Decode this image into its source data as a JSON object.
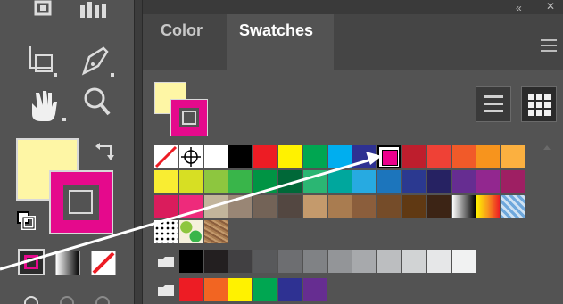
{
  "tabs": [
    {
      "label": "Color",
      "active": false
    },
    {
      "label": "Swatches",
      "active": true
    }
  ],
  "fill_color": "#fef6a5",
  "stroke_color": "#e5098c",
  "view_modes": [
    "list-view-icon",
    "grid-view-icon"
  ],
  "swatch_rows": [
    [
      "none",
      "registration",
      "#ffffff",
      "#000000",
      "#ed1c24",
      "#fff200",
      "#00a651",
      "#00aeef",
      "#2e3192",
      "#ec008c",
      "#be1e2d",
      "#ef4136",
      "#f15a29",
      "#f7941d",
      "#fbb040"
    ],
    [
      "#f9ed32",
      "#d7df23",
      "#8dc63f",
      "#39b54a",
      "#009444",
      "#006838",
      "#2bb673",
      "#00a79d",
      "#27aae1",
      "#1c75bc",
      "#2b3990",
      "#262262",
      "#662d91",
      "#92278f",
      "#9e1f63"
    ],
    [
      "#da1c5c",
      "#ee2a7b",
      "#c2b59b",
      "#998675",
      "#736357",
      "#534741",
      "#c49a6c",
      "#a97c50",
      "#8b5e3c",
      "#754c29",
      "#603913",
      "#3c2415",
      "gradient-bw",
      "gradient-orange",
      "pattern-blue"
    ],
    [
      "pattern-dots",
      "pattern-leaves",
      "pattern-texture"
    ],
    [
      "group",
      "#000000",
      "#231f20",
      "#414042",
      "#58595b",
      "#6d6e71",
      "#808285",
      "#939598",
      "#a7a9ac",
      "#bcbec0",
      "#d1d3d4",
      "#e6e7e8",
      "#f1f2f2"
    ],
    [
      "group",
      "#ed1c24",
      "#f26522",
      "#fff200",
      "#00a651",
      "#2e3192",
      "#662d91"
    ]
  ],
  "selected_swatch": "#ec008c",
  "annotation": {
    "arrow_color": "#ffffff"
  }
}
